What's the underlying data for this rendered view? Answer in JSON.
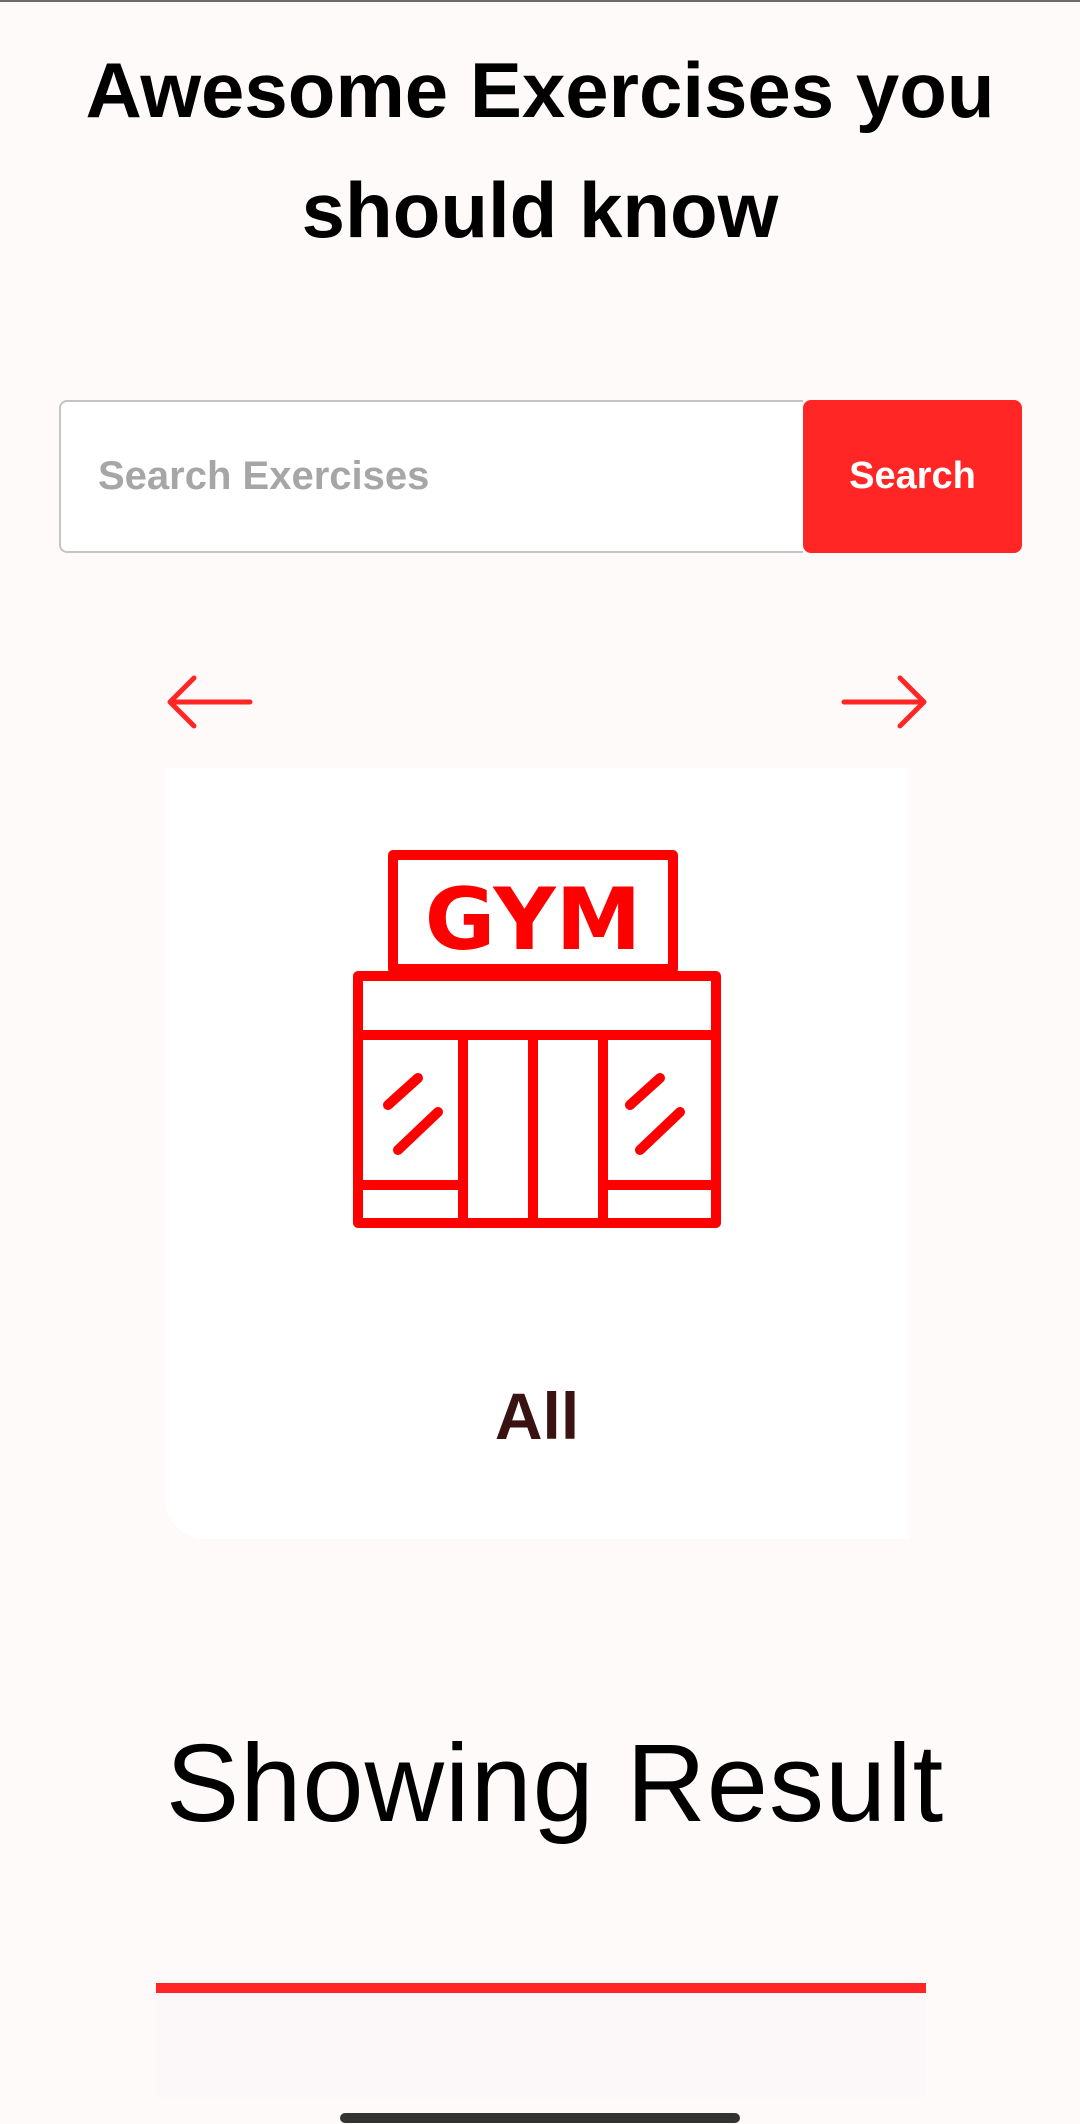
{
  "header": {
    "title": "Awesome Exercises you should know"
  },
  "search": {
    "placeholder": "Search Exercises",
    "value": "",
    "button_label": "Search"
  },
  "categories": {
    "selected": {
      "label": "All",
      "icon": "gym-building-icon",
      "icon_text": "GYM"
    }
  },
  "results": {
    "heading": "Showing Result"
  },
  "colors": {
    "accent": "#ff2625",
    "background": "#fffafa",
    "label_dark": "#3a1212"
  }
}
